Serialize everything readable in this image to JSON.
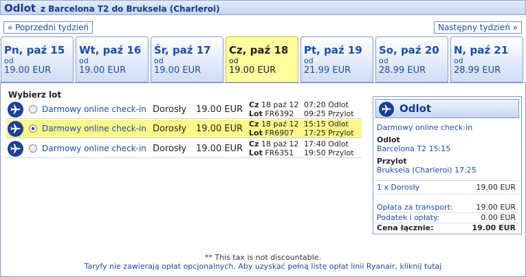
{
  "header": {
    "title": "Odlot",
    "route": "z Barcelona T2 do Bruksela (Charleroi)"
  },
  "nav": {
    "prev_label": "« Poprzedni tydzień",
    "next_label": "Następny tydzień »"
  },
  "days": [
    {
      "name": "Pn, paź 15",
      "from": "od",
      "price": "19.00 EUR",
      "selected": false
    },
    {
      "name": "Wt, paź 16",
      "from": "od",
      "price": "19.00 EUR",
      "selected": false
    },
    {
      "name": "Śr, paź 17",
      "from": "od",
      "price": "19.00 EUR",
      "selected": false
    },
    {
      "name": "Cz, paź 18",
      "from": "od",
      "price": "19.00 EUR",
      "selected": true
    },
    {
      "name": "Pt, paź 19",
      "from": "od",
      "price": "21.99 EUR",
      "selected": false
    },
    {
      "name": "So, paź 20",
      "from": "od",
      "price": "28.99 EUR",
      "selected": false
    },
    {
      "name": "N, paź 21",
      "from": "od",
      "price": "28.99 EUR",
      "selected": false
    }
  ],
  "flights_section": {
    "title": "Wybierz lot",
    "flights": [
      {
        "checkin": "Darmowy online check-in",
        "pax": "Dorosły",
        "price": "19.00 EUR",
        "day": "Cz",
        "date": "18 paź 12",
        "lot": "Lot",
        "flight_no": "FR6392",
        "dep": "07:20 Odlot",
        "arr": "09:25 Przylot",
        "selected": false
      },
      {
        "checkin": "Darmowy online check-in",
        "pax": "Dorosły",
        "price": "19.00 EUR",
        "day": "Cz",
        "date": "18 paź 12",
        "lot": "Lot",
        "flight_no": "FR6907",
        "dep": "15:15 Odlot",
        "arr": "17:25 Przylot",
        "selected": true
      },
      {
        "checkin": "Darmowy online check-in",
        "pax": "Dorosły",
        "price": "19.00 EUR",
        "day": "Cz",
        "date": "18 paź 12",
        "lot": "Lot",
        "flight_no": "FR6351",
        "dep": "17:40 Odlot",
        "arr": "19:50 Przylot",
        "selected": false
      }
    ]
  },
  "summary": {
    "title": "Odlot",
    "checkin": "Darmowy online check-in",
    "dep_label": "Odlot",
    "dep_value": "Barcelona T2 15:15",
    "arr_label": "Przylot",
    "arr_value": "Bruksela (Charleroi) 17:25",
    "pax_label": "1 x Dorosły",
    "pax_value": "19.00 EUR",
    "transport_label": "Opłata za transport:",
    "transport_value": "19.00 EUR",
    "tax_label": "Podatek i opłaty:",
    "tax_value": "0.00 EUR",
    "total_label": "Cena łącznie:",
    "total_value": "19.00 EUR"
  },
  "notes": {
    "tax_note": "** This tax is not discountable.",
    "fees_link": "Taryfy nie zawierają opłat opcjonalnych. Aby uzyskać pełną listę opłat linii Ryanair, kliknij tutaj"
  },
  "colors": {
    "brand": "#123a8c",
    "link": "#1a4dab",
    "highlight": "#fdf889",
    "selected_tab": "#ffffa0"
  }
}
